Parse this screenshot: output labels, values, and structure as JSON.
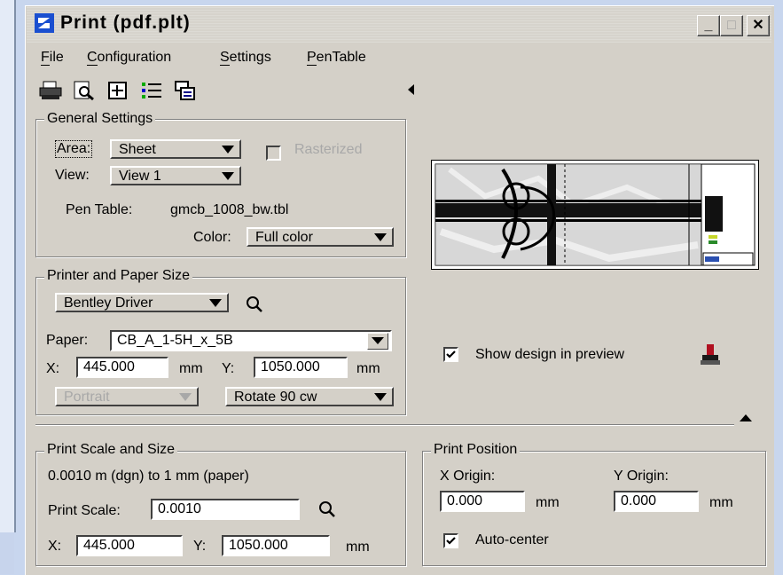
{
  "window": {
    "title": "Print  (pdf.plt)",
    "controls": {
      "minimize": "_",
      "maximize": "□",
      "close": "✕"
    }
  },
  "menu": {
    "file": "File",
    "configuration": "Configuration",
    "settings": "Settings",
    "pentable": "PenTable"
  },
  "toolbar": {
    "icons": [
      "printer-icon",
      "preview-icon",
      "fit-icon",
      "list-icon",
      "export-icon"
    ]
  },
  "general_settings": {
    "title": "General Settings",
    "area_label": "Area:",
    "area_value": "Sheet",
    "rasterized_label": "Rasterized",
    "rasterized_checked": false,
    "view_label": "View:",
    "view_value": "View 1",
    "pen_table_label": "Pen Table:",
    "pen_table_value": "gmcb_1008_bw.tbl",
    "color_label": "Color:",
    "color_value": "Full color"
  },
  "printer_paper": {
    "title": "Printer and Paper Size",
    "driver_value": "Bentley Driver",
    "paper_label": "Paper:",
    "paper_value": "CB_A_1-5H_x_5B",
    "x_label": "X:",
    "x_value": "445.000",
    "x_unit": "mm",
    "y_label": "Y:",
    "y_value": "1050.000",
    "y_unit": "mm",
    "orientation_value": "Portrait",
    "rotate_value": "Rotate 90 cw"
  },
  "preview": {
    "show_design_label": "Show design in preview",
    "show_design_checked": true
  },
  "print_scale": {
    "title": "Print Scale and Size",
    "ratio_text": "0.0010 m (dgn) to 1 mm (paper)",
    "scale_label": "Print Scale:",
    "scale_value": "0.0010",
    "x_label": "X:",
    "x_value": "445.000",
    "y_label": "Y:",
    "y_value": "1050.000",
    "unit": "mm"
  },
  "print_position": {
    "title": "Print Position",
    "x_origin_label": "X Origin:",
    "x_origin_value": "0.000",
    "x_unit": "mm",
    "y_origin_label": "Y Origin:",
    "y_origin_value": "0.000",
    "y_unit": "mm",
    "autocenter_label": "Auto-center",
    "autocenter_checked": true
  }
}
